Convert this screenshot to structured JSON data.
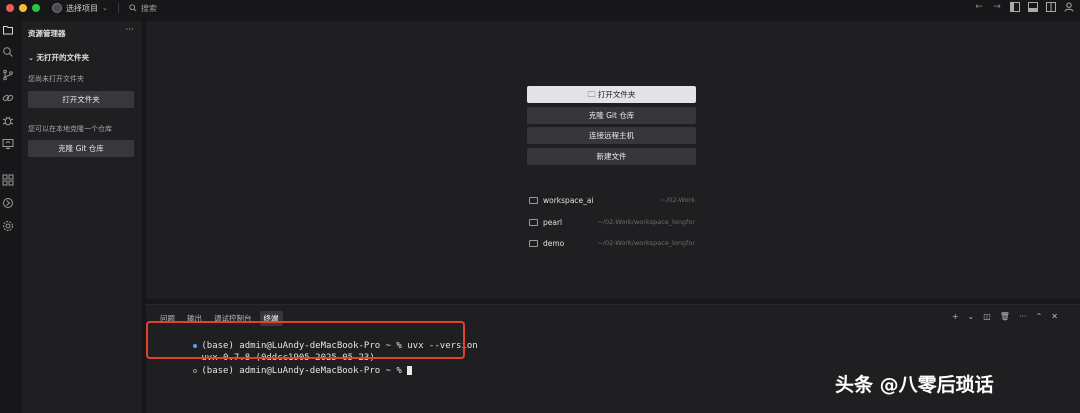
{
  "titlebar": {
    "project": "选择项目",
    "search": "搜索"
  },
  "sidebar": {
    "title": "资源管理器",
    "more": "···",
    "section": "无打开的文件夹",
    "no_folder_text": "您尚未打开文件夹",
    "open_folder_btn": "打开文件夹",
    "clone_text": "您可以在本地克隆一个仓库",
    "clone_btn": "克隆 Git 仓库"
  },
  "welcome": {
    "open_folder": "打开文件夹",
    "clone_git": "克隆 Git 仓库",
    "connect_remote": "连接远程主机",
    "new_file": "新建文件",
    "recent": [
      {
        "name": "workspace_ai",
        "path": "~/02-Work"
      },
      {
        "name": "pearl",
        "path": "~/02-Work/workspace_longfor"
      },
      {
        "name": "demo",
        "path": "~/02-Work/workspace_longfor"
      }
    ]
  },
  "panel": {
    "tabs": [
      "问题",
      "输出",
      "调试控制台",
      "终端"
    ],
    "active_tab": 3,
    "tools": [
      "+",
      "⌄",
      "◫",
      "🗑",
      "···",
      "⌃",
      "✕"
    ]
  },
  "terminal": {
    "line1": "(base) admin@LuAndy-deMacBook-Pro ~ % uvx --version",
    "line2": "uvx 0.7.8 (0ddcc1905 2025-05-23)",
    "line3": "(base) admin@LuAndy-deMacBook-Pro ~ % "
  },
  "watermark": "头条 @八零后琐话",
  "colors": {
    "background": "#17171a",
    "panel": "#1f1f22",
    "highlight_border": "#e0422c",
    "primary_button": "#e3e4e8"
  }
}
